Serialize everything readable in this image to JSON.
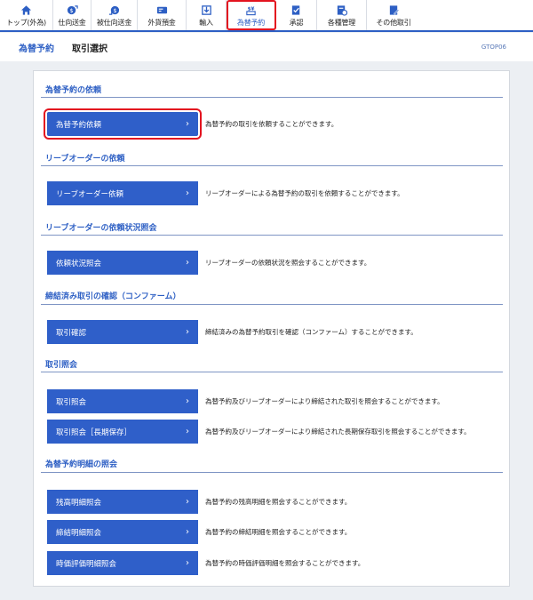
{
  "nav": {
    "items": [
      {
        "label": "トップ(外為)",
        "icon": "home-icon"
      },
      {
        "label": "仕向送金",
        "icon": "outbound-remittance-icon"
      },
      {
        "label": "被仕向送金",
        "icon": "inbound-remittance-icon"
      },
      {
        "label": "外貨預金",
        "icon": "foreign-deposit-icon"
      },
      {
        "label": "輸入",
        "icon": "import-icon"
      },
      {
        "label": "為替予約",
        "icon": "fx-contract-icon"
      },
      {
        "label": "承認",
        "icon": "approval-icon"
      },
      {
        "label": "各種管理",
        "icon": "management-icon"
      },
      {
        "label": "その他取引",
        "icon": "other-transactions-icon"
      }
    ],
    "active_label": "為替予約",
    "accent": "#2d5fc4",
    "highlight": "#e3131f"
  },
  "header": {
    "section": "為替予約",
    "page_title": "取引選択",
    "screen_id": "GTOP06"
  },
  "sections": [
    {
      "title": "為替予約の依頼",
      "rows": [
        {
          "button": "為替予約依頼",
          "description": "為替予約の取引を依頼することができます。",
          "highlighted": true
        }
      ]
    },
    {
      "title": "リーブオーダーの依頼",
      "rows": [
        {
          "button": "リーブオーダー依頼",
          "description": "リーブオーダーによる為替予約の取引を依頼することができます。"
        }
      ]
    },
    {
      "title": "リーブオーダーの依頼状況照会",
      "rows": [
        {
          "button": "依頼状況照会",
          "description": "リーブオーダーの依頼状況を照会することができます。"
        }
      ]
    },
    {
      "title": "締結済み取引の確認（コンファーム）",
      "rows": [
        {
          "button": "取引確認",
          "description": "締結済みの為替予約取引を確認（コンファーム）することができます。"
        }
      ]
    },
    {
      "title": "取引照会",
      "rows": [
        {
          "button": "取引照会",
          "description": "為替予約及びリーブオーダーにより締結された取引を照会することができます。"
        },
        {
          "button": "取引照会［長期保存］",
          "description": "為替予約及びリーブオーダーにより締結された長期保存取引を照会することができます。"
        }
      ]
    },
    {
      "title": "為替予約明細の照会",
      "rows": [
        {
          "button": "残高明細照会",
          "description": "為替予約の残高明細を照会することができます。"
        },
        {
          "button": "締結明細照会",
          "description": "為替予約の締結明細を照会することができます。"
        },
        {
          "button": "時価評価明細照会",
          "description": "為替予約の時価評価明細を照会することができます。"
        }
      ]
    }
  ],
  "chevron": "›"
}
